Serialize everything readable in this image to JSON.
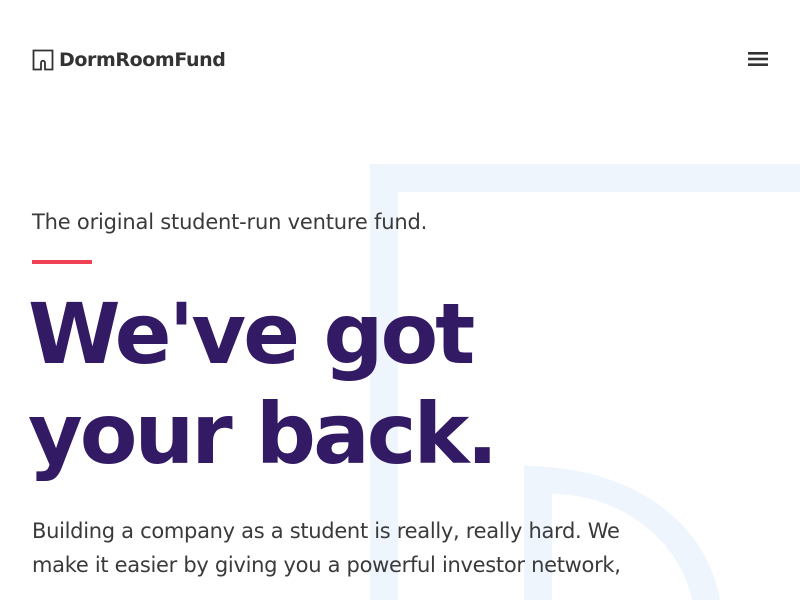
{
  "header": {
    "logo_text": "DormRoomFund",
    "logo_icon": "dormroomfund-logo-icon",
    "menu_icon": "hamburger-menu-icon"
  },
  "hero": {
    "tagline": "The original student-run venture fund.",
    "headline_line1": "We've got",
    "headline_line2": "your back.",
    "description_line1": "Building a company as a student is really, really hard. We",
    "description_line2": "make it easier by giving you a powerful investor network,"
  },
  "colors": {
    "headline": "#331a65",
    "accent": "#f04155",
    "body_text": "#3a3a3a",
    "background_shape": "#eef5fd"
  }
}
